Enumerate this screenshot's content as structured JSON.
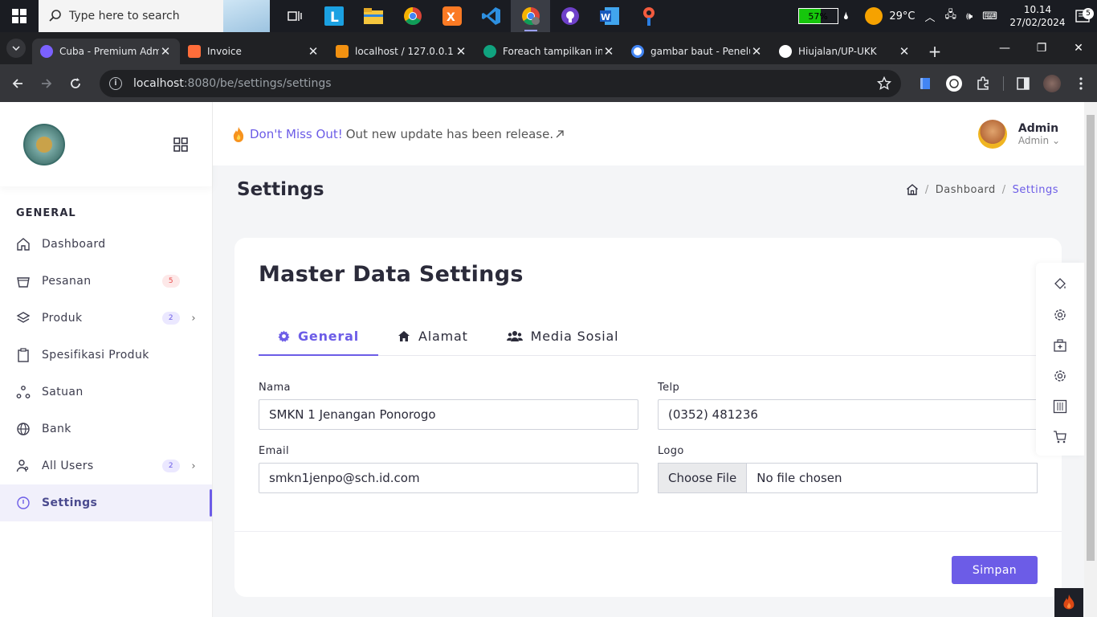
{
  "taskbar": {
    "search_placeholder": "Type here to search",
    "battery_percent": "57%",
    "battery_level": 0.57,
    "temperature": "29°C",
    "time": "10.14",
    "date": "27/02/2024",
    "notification_count": "5"
  },
  "browser": {
    "tabs": [
      {
        "label": "Cuba - Premium Admin",
        "color": "#7b61ff"
      },
      {
        "label": "Invoice",
        "color": "#ff6d3a"
      },
      {
        "label": "localhost / 127.0.0.1 / ...",
        "color": "#f29111"
      },
      {
        "label": "Foreach tampilkan in...",
        "color": "#10a37f"
      },
      {
        "label": "gambar baut - Penelu...",
        "color": "#ffffff"
      },
      {
        "label": "Hiujalan/UP-UKK",
        "color": "#ffffff"
      }
    ],
    "url_host": "localhost",
    "url_path": ":8080/be/settings/settings"
  },
  "header": {
    "announce_highlight": "Don't Miss Out!",
    "announce_text": "Out new update has been release.",
    "user_name": "Admin",
    "user_role": "Admin"
  },
  "sidebar": {
    "section": "GENERAL",
    "items": [
      {
        "label": "Dashboard"
      },
      {
        "label": "Pesanan",
        "badge": "5"
      },
      {
        "label": "Produk",
        "badge": "2"
      },
      {
        "label": "Spesifikasi Produk"
      },
      {
        "label": "Satuan"
      },
      {
        "label": "Bank"
      },
      {
        "label": "All Users",
        "badge": "2"
      },
      {
        "label": "Settings"
      }
    ]
  },
  "page": {
    "title": "Settings",
    "breadcrumb": [
      "Dashboard",
      "Settings"
    ]
  },
  "card": {
    "title": "Master Data Settings",
    "tabs": [
      "General",
      "Alamat",
      "Media Sosial"
    ],
    "fields": {
      "nama_label": "Nama",
      "nama_value": "SMKN 1 Jenangan Ponorogo",
      "telp_label": "Telp",
      "telp_value": "(0352) 481236",
      "email_label": "Email",
      "email_value": "smkn1jenpo@sch.id.com",
      "logo_label": "Logo",
      "file_button": "Choose File",
      "file_status": "No file chosen"
    },
    "save_label": "Simpan"
  },
  "colors": {
    "accent": "#6c5ce7"
  }
}
